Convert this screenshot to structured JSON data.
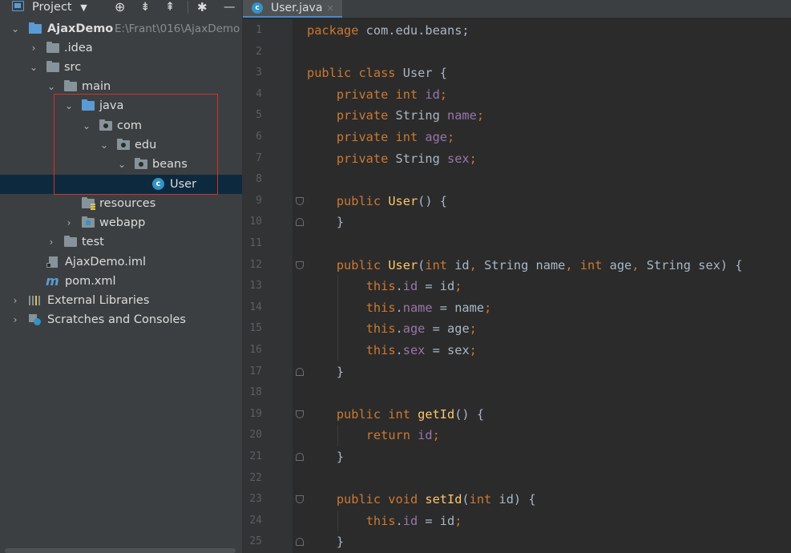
{
  "project_panel": {
    "title": "Project",
    "tree": [
      {
        "label": "AjaxDemo",
        "path": "E:\\Frant\\016\\AjaxDemo",
        "icon": "module-folder-icon"
      },
      {
        "label": ".idea",
        "icon": "folder-icon"
      },
      {
        "label": "src",
        "icon": "folder-icon"
      },
      {
        "label": "main",
        "icon": "folder-icon"
      },
      {
        "label": "java",
        "icon": "source-folder-icon"
      },
      {
        "label": "com",
        "icon": "package-icon"
      },
      {
        "label": "edu",
        "icon": "package-icon"
      },
      {
        "label": "beans",
        "icon": "package-icon"
      },
      {
        "label": "User",
        "icon": "java-class-icon"
      },
      {
        "label": "resources",
        "icon": "resources-folder-icon"
      },
      {
        "label": "webapp",
        "icon": "web-folder-icon"
      },
      {
        "label": "test",
        "icon": "folder-icon"
      },
      {
        "label": "AjaxDemo.iml",
        "icon": "iml-file-icon"
      },
      {
        "label": "pom.xml",
        "icon": "maven-icon"
      },
      {
        "label": "External Libraries",
        "icon": "libraries-icon"
      },
      {
        "label": "Scratches and Consoles",
        "icon": "scratches-icon"
      }
    ]
  },
  "editor": {
    "tab_label": "User.java",
    "tab_close": "×",
    "class_icon_letter": "c",
    "lines": [
      {
        "n": "1",
        "code": [
          [
            "kw",
            "package"
          ],
          [
            "nm",
            " com.edu.beans;"
          ]
        ]
      },
      {
        "n": "2",
        "code": []
      },
      {
        "n": "3",
        "code": [
          [
            "kw",
            "public class "
          ],
          [
            "nm",
            "User {"
          ]
        ]
      },
      {
        "n": "4",
        "code": [
          [
            "nm",
            "    "
          ],
          [
            "kw",
            "private int "
          ],
          [
            "fld",
            "id"
          ],
          [
            "kw",
            ";"
          ]
        ]
      },
      {
        "n": "5",
        "code": [
          [
            "nm",
            "    "
          ],
          [
            "kw",
            "private "
          ],
          [
            "nm",
            "String "
          ],
          [
            "fld",
            "name"
          ],
          [
            "kw",
            ";"
          ]
        ]
      },
      {
        "n": "6",
        "code": [
          [
            "nm",
            "    "
          ],
          [
            "kw",
            "private int "
          ],
          [
            "fld",
            "age"
          ],
          [
            "kw",
            ";"
          ]
        ]
      },
      {
        "n": "7",
        "code": [
          [
            "nm",
            "    "
          ],
          [
            "kw",
            "private "
          ],
          [
            "nm",
            "String "
          ],
          [
            "fld",
            "sex"
          ],
          [
            "kw",
            ";"
          ]
        ]
      },
      {
        "n": "8",
        "code": []
      },
      {
        "n": "9",
        "code": [
          [
            "nm",
            "    "
          ],
          [
            "kw",
            "public "
          ],
          [
            "mth",
            "User"
          ],
          [
            "nm",
            "() {"
          ]
        ]
      },
      {
        "n": "10",
        "code": [
          [
            "nm",
            "    }"
          ]
        ]
      },
      {
        "n": "11",
        "code": []
      },
      {
        "n": "12",
        "code": [
          [
            "nm",
            "    "
          ],
          [
            "kw",
            "public "
          ],
          [
            "mth",
            "User"
          ],
          [
            "nm",
            "("
          ],
          [
            "kw",
            "int "
          ],
          [
            "nm",
            "id"
          ],
          [
            "kw",
            ", "
          ],
          [
            "nm",
            "String name"
          ],
          [
            "kw",
            ", int "
          ],
          [
            "nm",
            "age"
          ],
          [
            "kw",
            ", "
          ],
          [
            "nm",
            "String sex) {"
          ]
        ]
      },
      {
        "n": "13",
        "code": [
          [
            "nm",
            "        "
          ],
          [
            "kw",
            "this"
          ],
          [
            "nm",
            "."
          ],
          [
            "fld",
            "id"
          ],
          [
            "nm",
            " = id"
          ],
          [
            "kw",
            ";"
          ]
        ]
      },
      {
        "n": "14",
        "code": [
          [
            "nm",
            "        "
          ],
          [
            "kw",
            "this"
          ],
          [
            "nm",
            "."
          ],
          [
            "fld",
            "name"
          ],
          [
            "nm",
            " = name"
          ],
          [
            "kw",
            ";"
          ]
        ]
      },
      {
        "n": "15",
        "code": [
          [
            "nm",
            "        "
          ],
          [
            "kw",
            "this"
          ],
          [
            "nm",
            "."
          ],
          [
            "fld",
            "age"
          ],
          [
            "nm",
            " = age"
          ],
          [
            "kw",
            ";"
          ]
        ]
      },
      {
        "n": "16",
        "code": [
          [
            "nm",
            "        "
          ],
          [
            "kw",
            "this"
          ],
          [
            "nm",
            "."
          ],
          [
            "fld",
            "sex"
          ],
          [
            "nm",
            " = sex"
          ],
          [
            "kw",
            ";"
          ]
        ]
      },
      {
        "n": "17",
        "code": [
          [
            "nm",
            "    }"
          ]
        ]
      },
      {
        "n": "18",
        "code": []
      },
      {
        "n": "19",
        "code": [
          [
            "nm",
            "    "
          ],
          [
            "kw",
            "public int "
          ],
          [
            "mth",
            "getId"
          ],
          [
            "nm",
            "() {"
          ]
        ]
      },
      {
        "n": "20",
        "code": [
          [
            "nm",
            "        "
          ],
          [
            "kw",
            "return "
          ],
          [
            "fld",
            "id"
          ],
          [
            "kw",
            ";"
          ]
        ]
      },
      {
        "n": "21",
        "code": [
          [
            "nm",
            "    }"
          ]
        ]
      },
      {
        "n": "22",
        "code": []
      },
      {
        "n": "23",
        "code": [
          [
            "nm",
            "    "
          ],
          [
            "kw",
            "public void "
          ],
          [
            "mth",
            "setId"
          ],
          [
            "nm",
            "("
          ],
          [
            "kw",
            "int "
          ],
          [
            "nm",
            "id) {"
          ]
        ]
      },
      {
        "n": "24",
        "code": [
          [
            "nm",
            "        "
          ],
          [
            "kw",
            "this"
          ],
          [
            "nm",
            "."
          ],
          [
            "fld",
            "id"
          ],
          [
            "nm",
            " = id"
          ],
          [
            "kw",
            ";"
          ]
        ]
      },
      {
        "n": "25",
        "code": [
          [
            "nm",
            "    }"
          ]
        ]
      }
    ]
  },
  "colors": {
    "keyword": "#cc7832",
    "field": "#9876aa",
    "method": "#ffc66d",
    "text": "#a9b7c6",
    "highlight_box": "#d4312b"
  }
}
